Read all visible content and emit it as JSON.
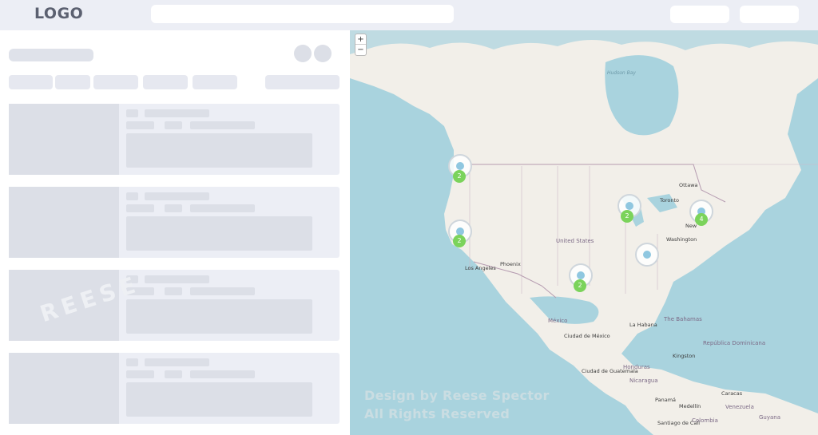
{
  "header": {
    "logo": "LOGO"
  },
  "map": {
    "zoom_in": "+",
    "zoom_out": "−",
    "labels": {
      "hudson_bay": "Hudson Bay",
      "united_states": "United States",
      "toronto": "Toronto",
      "ottawa": "Ottawa",
      "new_york": "New",
      "washington": "Washington",
      "phoenix": "Phoenix",
      "los_angeles": "Los Angeles",
      "mexico": "México",
      "ciudad_mexico": "Ciudad de México",
      "ciudad_guatemala": "Ciudad de Guatemala",
      "honduras": "Honduras",
      "nicaragua": "Nicaragua",
      "la_habana": "La Habana",
      "bahamas": "The Bahamas",
      "republica_dominicana": "República Dominicana",
      "kingston": "Kingston",
      "caracas": "Caracas",
      "venezuela": "Venezuela",
      "panama": "Panamá",
      "medellin": "Medellín",
      "colombia": "Colombia",
      "guyana": "Guyana",
      "santiago_de_cali": "Santiago de Cali"
    },
    "markers": [
      {
        "name": "seattle-cluster",
        "count": "2"
      },
      {
        "name": "san-francisco-cluster",
        "count": "2"
      },
      {
        "name": "chicago-cluster",
        "count": "2"
      },
      {
        "name": "new-york-cluster",
        "count": "4"
      },
      {
        "name": "houston-cluster",
        "count": "2"
      },
      {
        "name": "atlanta-marker",
        "count": ""
      }
    ],
    "watermark_line1": "Design by Reese Spector",
    "watermark_line2": "All Rights Reserved"
  },
  "left_watermark": "REESE"
}
